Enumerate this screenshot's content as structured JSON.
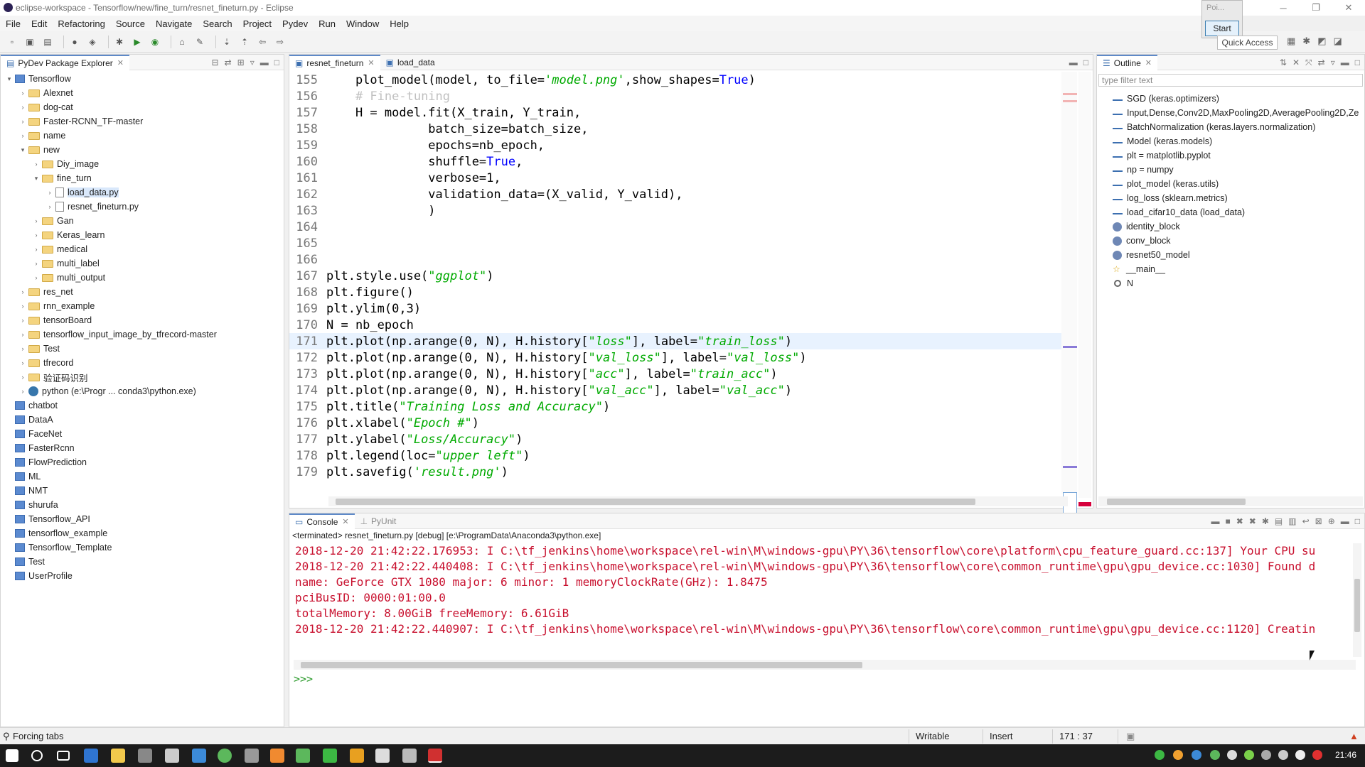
{
  "window": {
    "title": "eclipse-workspace - Tensorflow/new/fine_turn/resnet_fineturn.py - Eclipse"
  },
  "menu": [
    "File",
    "Edit",
    "Refactoring",
    "Source",
    "Navigate",
    "Search",
    "Project",
    "Pydev",
    "Run",
    "Window",
    "Help"
  ],
  "popup": {
    "label": "Poi...",
    "start_button": "Start"
  },
  "quick_access": "Quick Access",
  "explorer": {
    "title": "PyDev Package Explorer",
    "items": [
      {
        "label": "Tensorflow",
        "depth": 0,
        "kind": "project",
        "arrow": "▾"
      },
      {
        "label": "Alexnet",
        "depth": 1,
        "kind": "folder",
        "arrow": "›"
      },
      {
        "label": "dog-cat",
        "depth": 1,
        "kind": "folder",
        "arrow": "›"
      },
      {
        "label": "Faster-RCNN_TF-master",
        "depth": 1,
        "kind": "folder",
        "arrow": "›"
      },
      {
        "label": "name",
        "depth": 1,
        "kind": "folder",
        "arrow": "›"
      },
      {
        "label": "new",
        "depth": 1,
        "kind": "folder",
        "arrow": "▾"
      },
      {
        "label": "Diy_image",
        "depth": 2,
        "kind": "folder",
        "arrow": "›"
      },
      {
        "label": "fine_turn",
        "depth": 2,
        "kind": "folder",
        "arrow": "▾"
      },
      {
        "label": "load_data.py",
        "depth": 3,
        "kind": "file",
        "arrow": "›"
      },
      {
        "label": "resnet_fineturn.py",
        "depth": 3,
        "kind": "file",
        "arrow": "›"
      },
      {
        "label": "Gan",
        "depth": 2,
        "kind": "folder",
        "arrow": "›"
      },
      {
        "label": "Keras_learn",
        "depth": 2,
        "kind": "folder",
        "arrow": "›"
      },
      {
        "label": "medical",
        "depth": 2,
        "kind": "folder",
        "arrow": "›"
      },
      {
        "label": "multi_label",
        "depth": 2,
        "kind": "folder",
        "arrow": "›"
      },
      {
        "label": "multi_output",
        "depth": 2,
        "kind": "folder",
        "arrow": "›"
      },
      {
        "label": "res_net",
        "depth": 1,
        "kind": "folder",
        "arrow": "›"
      },
      {
        "label": "rnn_example",
        "depth": 1,
        "kind": "folder",
        "arrow": "›"
      },
      {
        "label": "tensorBoard",
        "depth": 1,
        "kind": "folder",
        "arrow": "›"
      },
      {
        "label": "tensorflow_input_image_by_tfrecord-master",
        "depth": 1,
        "kind": "folder",
        "arrow": "›"
      },
      {
        "label": "Test",
        "depth": 1,
        "kind": "folder",
        "arrow": "›"
      },
      {
        "label": "tfrecord",
        "depth": 1,
        "kind": "folder",
        "arrow": "›"
      },
      {
        "label": "验证码识别",
        "depth": 1,
        "kind": "folder",
        "arrow": "›"
      },
      {
        "label": "python   (e:\\Progr ... conda3\\python.exe)",
        "depth": 1,
        "kind": "interp",
        "arrow": "›"
      },
      {
        "label": "chatbot",
        "depth": 0,
        "kind": "project",
        "arrow": ""
      },
      {
        "label": "DataA",
        "depth": 0,
        "kind": "project",
        "arrow": ""
      },
      {
        "label": "FaceNet",
        "depth": 0,
        "kind": "project",
        "arrow": ""
      },
      {
        "label": "FasterRcnn",
        "depth": 0,
        "kind": "project",
        "arrow": ""
      },
      {
        "label": "FlowPrediction",
        "depth": 0,
        "kind": "project",
        "arrow": ""
      },
      {
        "label": "ML",
        "depth": 0,
        "kind": "project",
        "arrow": ""
      },
      {
        "label": "NMT",
        "depth": 0,
        "kind": "project",
        "arrow": ""
      },
      {
        "label": "shurufa",
        "depth": 0,
        "kind": "project",
        "arrow": ""
      },
      {
        "label": "Tensorflow_API",
        "depth": 0,
        "kind": "project",
        "arrow": ""
      },
      {
        "label": "tensorflow_example",
        "depth": 0,
        "kind": "project",
        "arrow": ""
      },
      {
        "label": "Tensorflow_Template",
        "depth": 0,
        "kind": "project",
        "arrow": ""
      },
      {
        "label": "Test",
        "depth": 0,
        "kind": "project",
        "arrow": ""
      },
      {
        "label": "UserProfile",
        "depth": 0,
        "kind": "project",
        "arrow": ""
      }
    ]
  },
  "editor": {
    "tabs": [
      "resnet_fineturn",
      "load_data"
    ],
    "current_line": "171",
    "lines": [
      {
        "n": "155",
        "html": "    plot_model(model, to_file=<span class='s'>'model.png'</span>,show_shapes=<span class='kw'>True</span>)"
      },
      {
        "n": "156",
        "html": "    <span class='cm'># Fine-tuning</span>"
      },
      {
        "n": "157",
        "html": "    H = model.fit(X_train, Y_train,"
      },
      {
        "n": "158",
        "html": "              batch_size=batch_size,"
      },
      {
        "n": "159",
        "html": "              epochs=nb_epoch,"
      },
      {
        "n": "160",
        "html": "              shuffle=<span class='kw'>True</span>,"
      },
      {
        "n": "161",
        "html": "              verbose=1,"
      },
      {
        "n": "162",
        "html": "              validation_data=(X_valid, Y_valid),"
      },
      {
        "n": "163",
        "html": "              )"
      },
      {
        "n": "164",
        "html": ""
      },
      {
        "n": "165",
        "html": ""
      },
      {
        "n": "166",
        "html": ""
      },
      {
        "n": "167",
        "html": "plt.style.use(<span class='s'>\"ggplot\"</span>)"
      },
      {
        "n": "168",
        "html": "plt.figure()"
      },
      {
        "n": "169",
        "html": "plt.ylim(0,3)"
      },
      {
        "n": "170",
        "html": "N = nb_epoch"
      },
      {
        "n": "171",
        "html": "plt.plot(np.arange(0, N), H.history[<span class='s'>\"loss\"</span>], label=<span class='s'>\"train_loss\"</span>)"
      },
      {
        "n": "172",
        "html": "plt.plot(np.arange(0, N), H.history[<span class='s'>\"val_loss\"</span>], label=<span class='s'>\"val_loss\"</span>)"
      },
      {
        "n": "173",
        "html": "plt.plot(np.arange(0, N), H.history[<span class='s'>\"acc\"</span>], label=<span class='s'>\"train_acc\"</span>)"
      },
      {
        "n": "174",
        "html": "plt.plot(np.arange(0, N), H.history[<span class='s'>\"val_acc\"</span>], label=<span class='s'>\"val_acc\"</span>)"
      },
      {
        "n": "175",
        "html": "plt.title(<span class='s'>\"Training Loss and Accuracy\"</span>)"
      },
      {
        "n": "176",
        "html": "plt.xlabel(<span class='s'>\"Epoch #\"</span>)"
      },
      {
        "n": "177",
        "html": "plt.ylabel(<span class='s'>\"Loss/Accuracy\"</span>)"
      },
      {
        "n": "178",
        "html": "plt.legend(loc=<span class='s'>\"upper left\"</span>)"
      },
      {
        "n": "179",
        "html": "plt.savefig(<span class='s'>'result.png'</span>)"
      }
    ]
  },
  "outline": {
    "title": "Outline",
    "filter_placeholder": "type filter text",
    "items": [
      {
        "label": "SGD (keras.optimizers)",
        "kind": "import"
      },
      {
        "label": "Input,Dense,Conv2D,MaxPooling2D,AveragePooling2D,Ze",
        "kind": "import"
      },
      {
        "label": "BatchNormalization (keras.layers.normalization)",
        "kind": "import"
      },
      {
        "label": "Model (keras.models)",
        "kind": "import"
      },
      {
        "label": "plt = matplotlib.pyplot",
        "kind": "import"
      },
      {
        "label": "np = numpy",
        "kind": "import"
      },
      {
        "label": "plot_model (keras.utils)",
        "kind": "import"
      },
      {
        "label": "log_loss (sklearn.metrics)",
        "kind": "import"
      },
      {
        "label": "load_cifar10_data (load_data)",
        "kind": "import"
      },
      {
        "label": "identity_block",
        "kind": "function"
      },
      {
        "label": "conv_block",
        "kind": "function"
      },
      {
        "label": "resnet50_model",
        "kind": "function"
      },
      {
        "label": "__main__",
        "kind": "main"
      },
      {
        "label": "N",
        "kind": "variable"
      }
    ]
  },
  "console": {
    "tabs": [
      "Console",
      "PyUnit"
    ],
    "header": "<terminated> resnet_fineturn.py [debug] [e:\\ProgramData\\Anaconda3\\python.exe]",
    "lines": [
      "2018-12-20 21:42:22.176953: I C:\\tf_jenkins\\home\\workspace\\rel-win\\M\\windows-gpu\\PY\\36\\tensorflow\\core\\platform\\cpu_feature_guard.cc:137] Your CPU su",
      "2018-12-20 21:42:22.440408: I C:\\tf_jenkins\\home\\workspace\\rel-win\\M\\windows-gpu\\PY\\36\\tensorflow\\core\\common_runtime\\gpu\\gpu_device.cc:1030] Found d",
      "name: GeForce GTX 1080 major: 6 minor: 1 memoryClockRate(GHz): 1.8475",
      "pciBusID: 0000:01:00.0",
      "totalMemory: 8.00GiB freeMemory: 6.61GiB",
      "2018-12-20 21:42:22.440907: I C:\\tf_jenkins\\home\\workspace\\rel-win\\M\\windows-gpu\\PY\\36\\tensorflow\\core\\common_runtime\\gpu\\gpu_device.cc:1120] Creatin"
    ],
    "prompt": ">>>"
  },
  "status": {
    "left": "Forcing tabs",
    "writable": "Writable",
    "insert": "Insert",
    "position": "171 : 37"
  },
  "taskbar": {
    "clock": "21:46"
  }
}
